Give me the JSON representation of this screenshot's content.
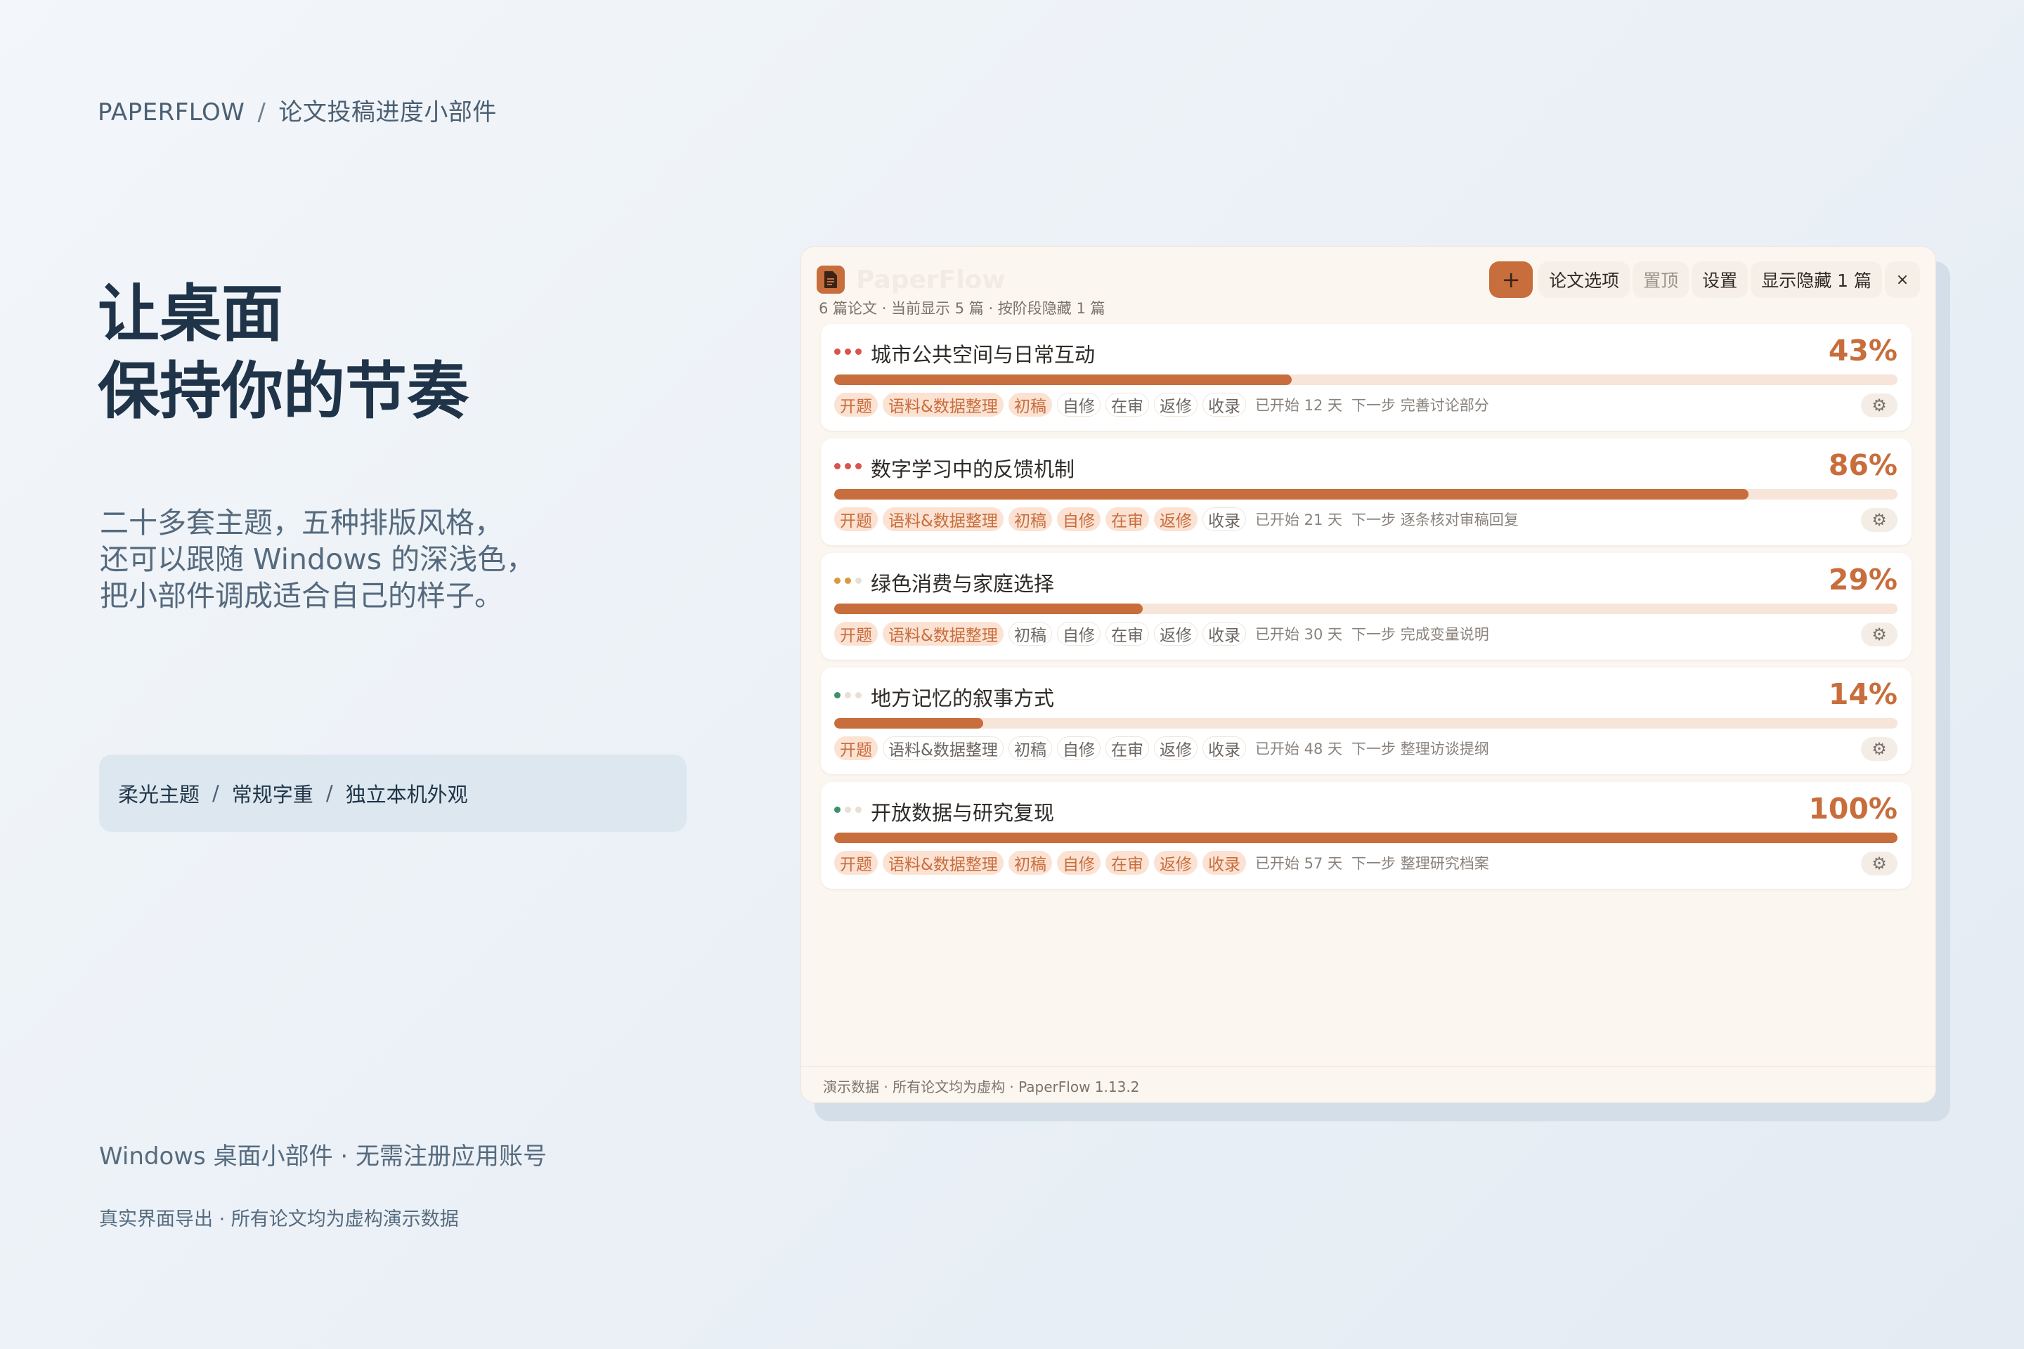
{
  "page": {
    "brand": "PAPERFLOW",
    "brand_separator": "/",
    "brand_subtitle": "论文投稿进度小部件",
    "headline_line1": "让桌面",
    "headline_line2": "保持你的节奏",
    "description_line1": "二十多套主题，五种排版风格，",
    "description_line2": "还可以跟随 Windows 的深浅色，",
    "description_line3": "把小部件调成适合自己的样子。",
    "features": [
      "柔光主题",
      "常规字重",
      "独立本机外观"
    ],
    "feature_separator": "/",
    "bottom_line": "Windows 桌面小部件 · 无需注册应用账号",
    "bottom_note": "真实界面导出 · 所有论文均为虚构演示数据"
  },
  "widget": {
    "app_name": "PaperFlow",
    "app_icon": "document-icon",
    "toolbar": {
      "add_label": "+",
      "options_label": "论文选项",
      "pin_label": "置顶",
      "settings_label": "设置",
      "show_hidden_label": "显示隐藏 1 篇",
      "close_label": "×"
    },
    "subtitle": "6 篇论文 · 当前显示 5 篇 · 按阶段隐藏 1 篇",
    "accent_color": "#c86d3c",
    "stage_labels": [
      "开题",
      "语料&数据整理",
      "初稿",
      "自修",
      "在审",
      "返修",
      "收录"
    ],
    "papers": [
      {
        "title": "城市公共空间与日常互动",
        "percent_label": "43%",
        "progress": 0.43,
        "dot_colors": [
          "#d9534f",
          "#d9534f",
          "#d9534f"
        ],
        "stages_done": 3,
        "started": "已开始 12 天",
        "next_step": "下一步 完善讨论部分"
      },
      {
        "title": "数字学习中的反馈机制",
        "percent_label": "86%",
        "progress": 0.86,
        "dot_colors": [
          "#d9534f",
          "#d9534f",
          "#d9534f"
        ],
        "stages_done": 6,
        "started": "已开始 21 天",
        "next_step": "下一步 逐条核对审稿回复"
      },
      {
        "title": "绿色消费与家庭选择",
        "percent_label": "29%",
        "progress": 0.29,
        "dot_colors": [
          "#d99a3c",
          "#d99a3c",
          "#eadfd3"
        ],
        "stages_done": 2,
        "started": "已开始 30 天",
        "next_step": "下一步 完成变量说明"
      },
      {
        "title": "地方记忆的叙事方式",
        "percent_label": "14%",
        "progress": 0.14,
        "dot_colors": [
          "#3f8f6d",
          "#eadfd3",
          "#eadfd3"
        ],
        "stages_done": 1,
        "started": "已开始 48 天",
        "next_step": "下一步 整理访谈提纲"
      },
      {
        "title": "开放数据与研究复现",
        "percent_label": "100%",
        "progress": 1.0,
        "dot_colors": [
          "#3f8f6d",
          "#eadfd3",
          "#eadfd3"
        ],
        "stages_done": 7,
        "started": "已开始 57 天",
        "next_step": "下一步 整理研究档案"
      }
    ],
    "card_action_icon": "gear-icon",
    "footer": "演示数据 · 所有论文均为虚构 · PaperFlow 1.13.2"
  }
}
